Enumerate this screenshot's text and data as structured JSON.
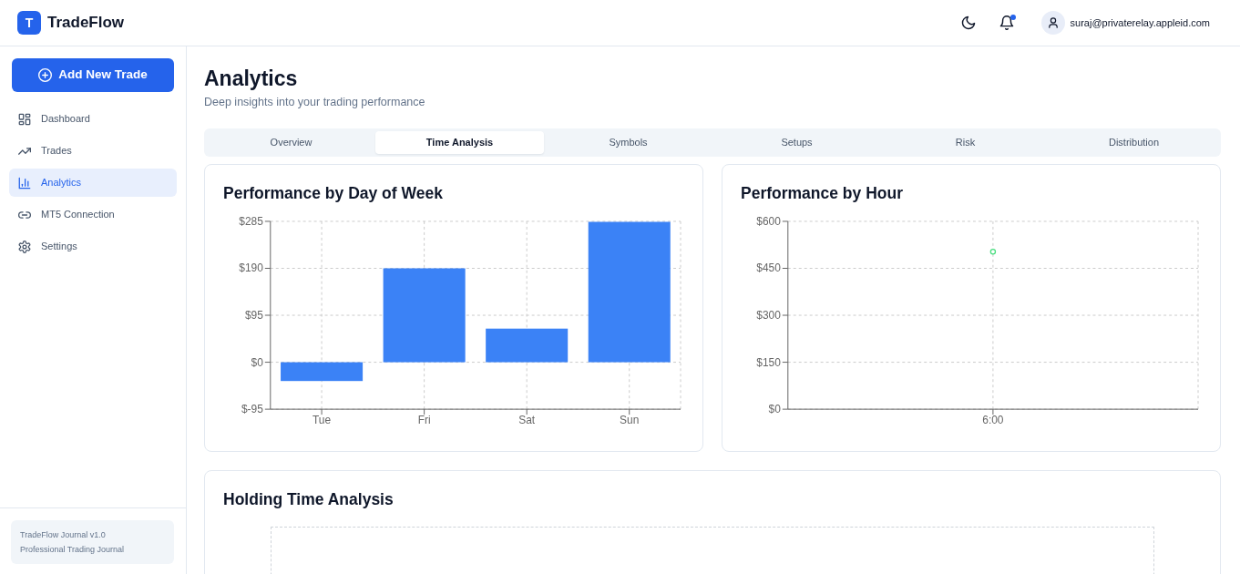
{
  "header": {
    "logo_letter": "T",
    "app_name": "TradeFlow",
    "has_unread_notifications": true,
    "user_email": "suraj@privaterelay.appleid.com"
  },
  "sidebar": {
    "primary_button": "Add New Trade",
    "items": [
      {
        "label": "Dashboard",
        "selected": false
      },
      {
        "label": "Trades",
        "selected": false
      },
      {
        "label": "Analytics",
        "selected": true
      },
      {
        "label": "MT5 Connection",
        "selected": false
      },
      {
        "label": "Settings",
        "selected": false
      }
    ],
    "footer": [
      "TradeFlow Journal v1.0",
      "Professional Trading Journal"
    ]
  },
  "page": {
    "title": "Analytics",
    "subtitle": "Deep insights into your trading performance"
  },
  "tabs": [
    {
      "label": "Overview",
      "selected": false
    },
    {
      "label": "Time Analysis",
      "selected": true
    },
    {
      "label": "Symbols",
      "selected": false
    },
    {
      "label": "Setups",
      "selected": false
    },
    {
      "label": "Risk",
      "selected": false
    },
    {
      "label": "Distribution",
      "selected": false
    }
  ],
  "cards": [
    {
      "title": "Performance by Day of Week",
      "chart_data": {
        "type": "bar",
        "categories": [
          "Tue",
          "Fri",
          "Sat",
          "Sun"
        ],
        "series": [
          {
            "color": "#3b82f6",
            "values": [
              -38,
              190,
              68,
              284
            ]
          }
        ],
        "ylim": [
          -95,
          285
        ],
        "yticks": [
          {
            "value": -95,
            "label": "$-95"
          },
          {
            "value": 0,
            "label": "$0"
          },
          {
            "value": 95,
            "label": "$95"
          },
          {
            "value": 190,
            "label": "$190"
          },
          {
            "value": 285,
            "label": "$285"
          }
        ],
        "grid": true
      }
    },
    {
      "title": "Performance by Hour",
      "chart_data": {
        "type": "scatter",
        "categories": [
          "6:00"
        ],
        "series": [
          {
            "color": "#4ade80",
            "values": [
              503
            ]
          }
        ],
        "ylim": [
          0,
          600
        ],
        "yticks": [
          {
            "value": 0,
            "label": "$0"
          },
          {
            "value": 150,
            "label": "$150"
          },
          {
            "value": 300,
            "label": "$300"
          },
          {
            "value": 450,
            "label": "$450"
          },
          {
            "value": 600,
            "label": "$600"
          }
        ],
        "grid": true
      }
    },
    {
      "title": "Holding Time Analysis"
    }
  ]
}
